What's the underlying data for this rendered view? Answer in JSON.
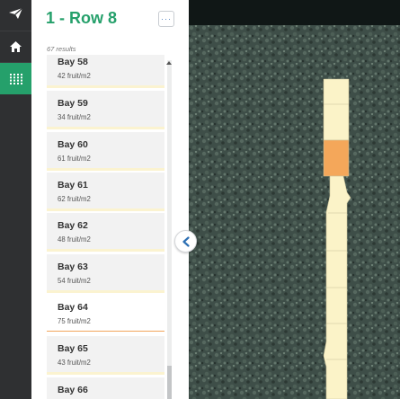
{
  "panel": {
    "title": "1 - Row 8",
    "more_label": "···",
    "results_count": "67 results"
  },
  "bays": [
    {
      "name": "Bay 58",
      "value": "42 fruit/m2"
    },
    {
      "name": "Bay 59",
      "value": "34 fruit/m2"
    },
    {
      "name": "Bay 60",
      "value": "61 fruit/m2"
    },
    {
      "name": "Bay 61",
      "value": "62 fruit/m2"
    },
    {
      "name": "Bay 62",
      "value": "48 fruit/m2"
    },
    {
      "name": "Bay 63",
      "value": "54 fruit/m2"
    },
    {
      "name": "Bay 64",
      "value": "75 fruit/m2",
      "selected": true
    },
    {
      "name": "Bay 65",
      "value": "43 fruit/m2"
    },
    {
      "name": "Bay 66",
      "value": ""
    }
  ],
  "colors": {
    "accent": "#25a06b",
    "rail": "#2f3032",
    "bay_default": "#fbf3c8",
    "bay_highlight": "#f4a75a",
    "foliage": "#3e4e48"
  },
  "icons": {
    "logo": "paper-plane-icon",
    "home": "home-icon",
    "grid": "grid-icon",
    "collapse": "chevron-left-icon"
  }
}
